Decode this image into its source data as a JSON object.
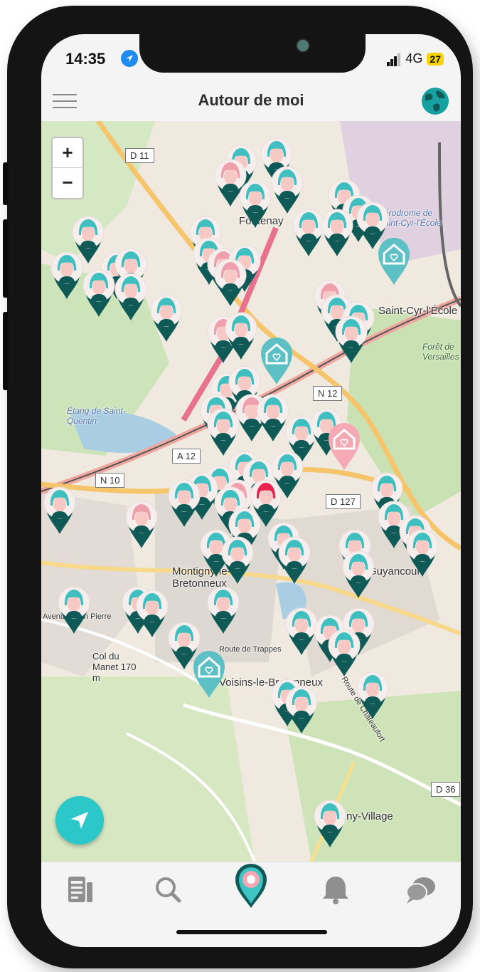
{
  "status": {
    "time": "14:35",
    "network": "4G",
    "battery": "27"
  },
  "header": {
    "title": "Autour de moi"
  },
  "map": {
    "zoom_in": "+",
    "zoom_out": "−",
    "roads": [
      "D 11",
      "N 12",
      "A 12",
      "N 10",
      "D 127",
      "D 36"
    ],
    "places": [
      "Fontenay",
      "Aérodrome de Saint-Cyr-l'École",
      "Saint-Cyr-l'École",
      "Forêt de Versailles",
      "Étang de Saint-Quentin",
      "Montigny-le-Bretonneux",
      "Guyancourt",
      "Col du Manet 170 m",
      "Voisins-le-Bretonneux",
      "Magny-Village",
      "Route de Trappes",
      "Route de Châteaufort",
      "Avenue Jean Pierre"
    ]
  },
  "tabs": [
    "news",
    "search",
    "map",
    "notifications",
    "messages"
  ],
  "colors": {
    "accent": "#2bc7c9",
    "teal_dark": "#0f5a57",
    "pink": "#f2a7b2",
    "hair_teal": "#3fbfbf"
  }
}
